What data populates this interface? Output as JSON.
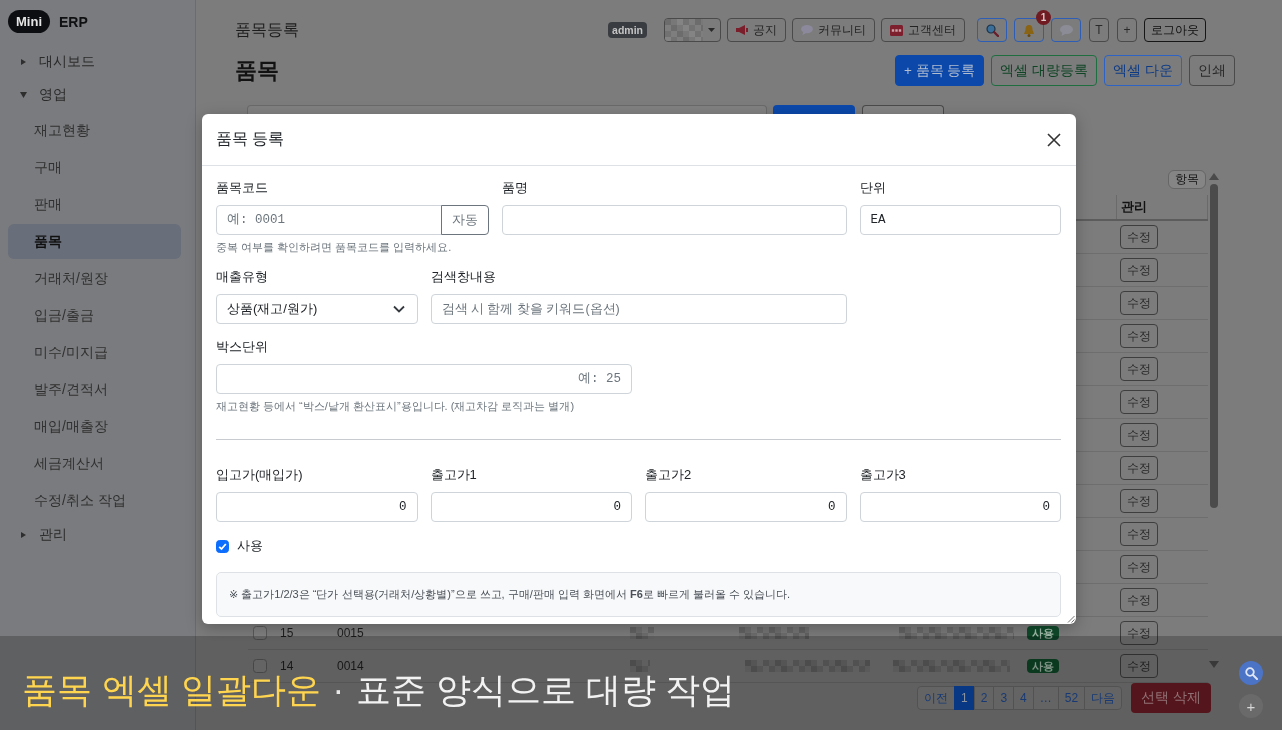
{
  "sidebar": {
    "logo_badge": "Mini",
    "logo_text": "ERP",
    "items": [
      {
        "label": "대시보드",
        "expanded": false
      },
      {
        "label": "영업",
        "expanded": true,
        "children": [
          {
            "label": "재고현황",
            "selected": false
          },
          {
            "label": "구매",
            "selected": false
          },
          {
            "label": "판매",
            "selected": false
          },
          {
            "label": "품목",
            "selected": true
          },
          {
            "label": "거래처/원장",
            "selected": false
          },
          {
            "label": "입금/출금",
            "selected": false
          },
          {
            "label": "미수/미지급",
            "selected": false
          },
          {
            "label": "발주/견적서",
            "selected": false
          },
          {
            "label": "매입/매출장",
            "selected": false
          },
          {
            "label": "세금계산서",
            "selected": false
          },
          {
            "label": "수정/취소 작업",
            "selected": false
          }
        ]
      },
      {
        "label": "관리",
        "expanded": false
      }
    ]
  },
  "topbar": {
    "title": "품목등록",
    "role_badge": "admin",
    "links": [
      "공지",
      "커뮤니티",
      "고객센터"
    ],
    "notification_count": "1",
    "text_buttons": [
      "T",
      "+"
    ],
    "logout": "로그아웃"
  },
  "page": {
    "heading": "품목",
    "actions": [
      {
        "kind": "primary",
        "label": "+ 품목 등록"
      },
      {
        "kind": "success",
        "label": "엑셀 대량등록"
      },
      {
        "kind": "info",
        "label": "엑셀 다운"
      },
      {
        "kind": "secondary",
        "label": "인쇄"
      }
    ]
  },
  "table": {
    "settings_button": "항목",
    "action_column": "관리",
    "rows": [
      {
        "action": "수정"
      },
      {
        "action": "수정"
      },
      {
        "action": "수정"
      },
      {
        "action": "수정"
      },
      {
        "action": "수정"
      },
      {
        "action": "수정"
      },
      {
        "action": "수정"
      },
      {
        "action": "수정"
      },
      {
        "action": "수정"
      },
      {
        "action": "수정"
      },
      {
        "action": "수정"
      },
      {
        "action": "수정"
      },
      {
        "checked": false,
        "no": "15",
        "code": "0015",
        "status": "사용",
        "action": "수정"
      },
      {
        "checked": false,
        "no": "14",
        "code": "0014",
        "status": "사용",
        "action": "수정"
      }
    ]
  },
  "pagination": {
    "prev": "이전",
    "pages": [
      {
        "label": "1",
        "selected": true
      },
      {
        "label": "2",
        "selected": false
      },
      {
        "label": "3",
        "selected": false
      },
      {
        "label": "4",
        "selected": false
      },
      {
        "label": "…",
        "selected": false
      },
      {
        "label": "52",
        "selected": false
      }
    ],
    "next": "다음"
  },
  "delete_button": "선택 삭제",
  "modal": {
    "title": "품목 등록",
    "rows": [
      {
        "fields": [
          {
            "kind": "code",
            "label": "품목코드",
            "placeholder": "예: 0001",
            "button": "자동"
          },
          {
            "kind": "text",
            "label": "품명"
          },
          {
            "kind": "mono",
            "label": "단위",
            "value": "EA"
          }
        ],
        "help": "중복 여부를 확인하려면 품목코드를 입력하세요."
      },
      {
        "fields": [
          {
            "kind": "select",
            "label": "매출유형",
            "value": "상품(재고/원가)"
          },
          {
            "kind": "text",
            "label": "검색창내용",
            "placeholder": "검색 시 함께 찾을 키워드(옵션)"
          }
        ]
      },
      {
        "fields": [
          {
            "kind": "number",
            "label": "박스단위",
            "placeholder": "예: 25"
          }
        ],
        "help": "재고현황 등에서 “박스/낱개 환산표시”용입니다. (재고차감 로직과는 별개)"
      }
    ],
    "prices": [
      {
        "kind": "number",
        "label": "입고가(매입가)",
        "value": "0"
      },
      {
        "kind": "number",
        "label": "출고가1",
        "value": "0"
      },
      {
        "kind": "number",
        "label": "출고가2",
        "value": "0"
      },
      {
        "kind": "number",
        "label": "출고가3",
        "value": "0"
      }
    ],
    "checkbox": {
      "label": "사용",
      "checked": true
    },
    "note": "※ 출고가1/2/3은 “단가 선택용(거래처/상황별)”으로 쓰고, 구매/판매 입력 화면에서 **F6**로 빠르게 불러올 수 있습니다."
  },
  "fab": {
    "add": "+"
  },
  "caption": {
    "highlight": "품목 엑셀 일괄다운",
    "separator": "·",
    "text": "표준 양식으로 대량 작업"
  }
}
